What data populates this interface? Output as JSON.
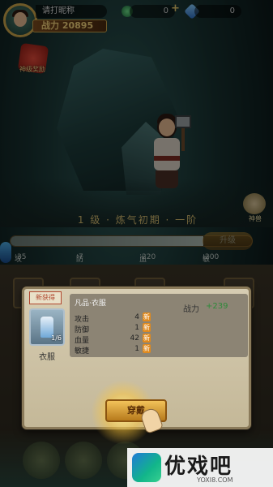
{
  "player": {
    "name": "请打昵称",
    "power": "战力 20895"
  },
  "resources": [
    {
      "icon": "jade-icon",
      "value": "0"
    },
    {
      "icon": "diamond-icon",
      "value": "0"
    }
  ],
  "reward": {
    "label": "神级奖励"
  },
  "stage": {
    "title": "1 级 · 炼气初期 · 一阶",
    "exp_fraction": 0.8
  },
  "pet": {
    "label": "神兽"
  },
  "upgrade_button": "升级",
  "stats": [
    {
      "label": "攻击",
      "value": "35"
    },
    {
      "label": "防御",
      "value": "7"
    },
    {
      "label": "血量",
      "value": "220"
    },
    {
      "label": "敏捷",
      "value": "200"
    }
  ],
  "dialog": {
    "badge": "新获得",
    "item_title": "凡品·衣服",
    "item_count": "1/6",
    "item_name": "衣服",
    "power_label": "战力",
    "power_value": "+239",
    "attrs": [
      {
        "label": "攻击",
        "value": "4",
        "tag": "新"
      },
      {
        "label": "防御",
        "value": "1",
        "tag": "新"
      },
      {
        "label": "血量",
        "value": "42",
        "tag": "新"
      },
      {
        "label": "敏捷",
        "value": "1",
        "tag": "新"
      }
    ],
    "wear_button": "穿戴"
  },
  "watermark": {
    "brand": "优戏吧",
    "url": "YOXI8.COM"
  },
  "colors": {
    "accent_gold": "#f3d27a",
    "positive": "#2e8a3a",
    "tag_orange": "#e08a1e"
  }
}
